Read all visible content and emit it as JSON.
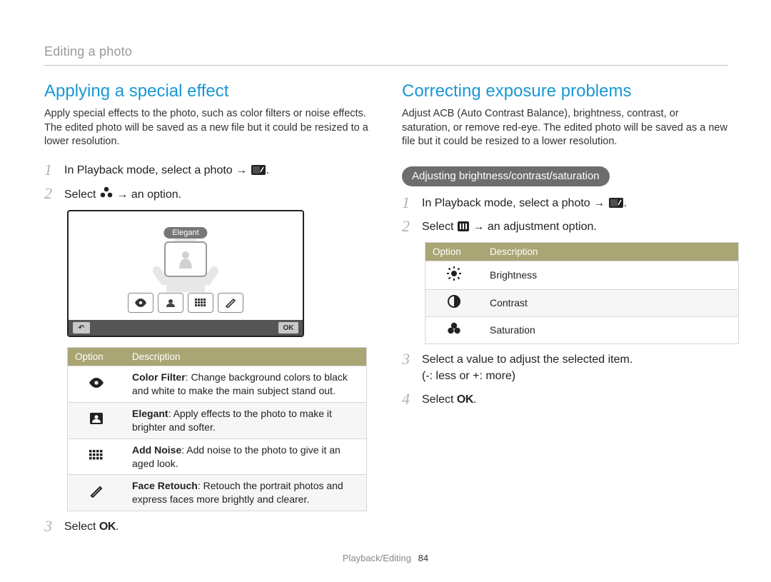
{
  "header": {
    "section_title": "Editing a photo"
  },
  "left": {
    "heading": "Applying a special effect",
    "intro": "Apply special effects to the photo, such as color filters or noise effects. The edited photo will be saved as a new file but it could be resized to a lower resolution.",
    "step1_a": "In Playback mode, select a photo → ",
    "step1_b": ".",
    "step2_a": "Select ",
    "step2_b": " → an option.",
    "screen": {
      "label": "Elegant",
      "back": "↶",
      "okbar": "OK"
    },
    "table": {
      "col_option": "Option",
      "col_desc": "Description",
      "rows": [
        {
          "name": "Color Filter",
          "desc_rest": ": Change background colors to black and white to make the main subject stand out."
        },
        {
          "name": "Elegant",
          "desc_rest": ": Apply effects to the photo to make it brighter and softer."
        },
        {
          "name": "Add Noise",
          "desc_rest": ": Add noise to the photo to give it an aged look."
        },
        {
          "name": "Face Retouch",
          "desc_rest": ": Retouch the portrait photos and express faces more brightly and clearer."
        }
      ]
    },
    "step3_a": "Select ",
    "step3_b": "."
  },
  "right": {
    "heading": "Correcting exposure problems",
    "intro": "Adjust ACB (Auto Contrast Balance), brightness, contrast, or saturation, or remove red-eye. The edited photo will be saved as a new file but it could be resized to a lower resolution.",
    "pill": "Adjusting brightness/contrast/saturation",
    "step1_a": "In Playback mode, select a photo → ",
    "step1_b": ".",
    "step2_a": "Select ",
    "step2_b": " → an adjustment option.",
    "table": {
      "col_option": "Option",
      "col_desc": "Description",
      "rows": [
        "Brightness",
        "Contrast",
        "Saturation"
      ]
    },
    "step3": "Select a value to adjust the selected item.\n(-: less or +: more)",
    "step4_a": "Select ",
    "step4_b": "."
  },
  "footer": {
    "chapter": "Playback/Editing",
    "page": "84"
  }
}
